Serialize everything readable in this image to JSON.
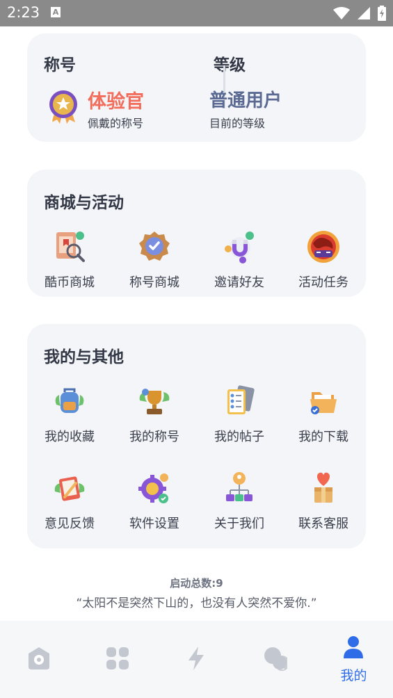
{
  "status_bar": {
    "time": "2:23",
    "notif": "A"
  },
  "profile": {
    "title_header": "称号",
    "level_header": "等级",
    "title_name": "体验官",
    "title_sub": "佩戴的称号",
    "level_name": "普通用户",
    "level_sub": "目前的等级"
  },
  "mall": {
    "header": "商城与活动",
    "items": [
      {
        "label": "酷币商城"
      },
      {
        "label": "称号商城"
      },
      {
        "label": "邀请好友"
      },
      {
        "label": "活动任务"
      }
    ]
  },
  "mine": {
    "header": "我的与其他",
    "items": [
      {
        "label": "我的收藏"
      },
      {
        "label": "我的称号"
      },
      {
        "label": "我的帖子"
      },
      {
        "label": "我的下载"
      },
      {
        "label": "意见反馈"
      },
      {
        "label": "软件设置"
      },
      {
        "label": "关于我们"
      },
      {
        "label": "联系客服"
      }
    ]
  },
  "footer": {
    "boot_count": "启动总数:9",
    "quote": "“太阳不是突然下山的，也没有人突然不爱你.”"
  },
  "nav": {
    "active_label": "我的"
  },
  "colors": {
    "accent": "#2f6de8",
    "title_red": "#f26d5b",
    "level_blue": "#5a6a93"
  }
}
